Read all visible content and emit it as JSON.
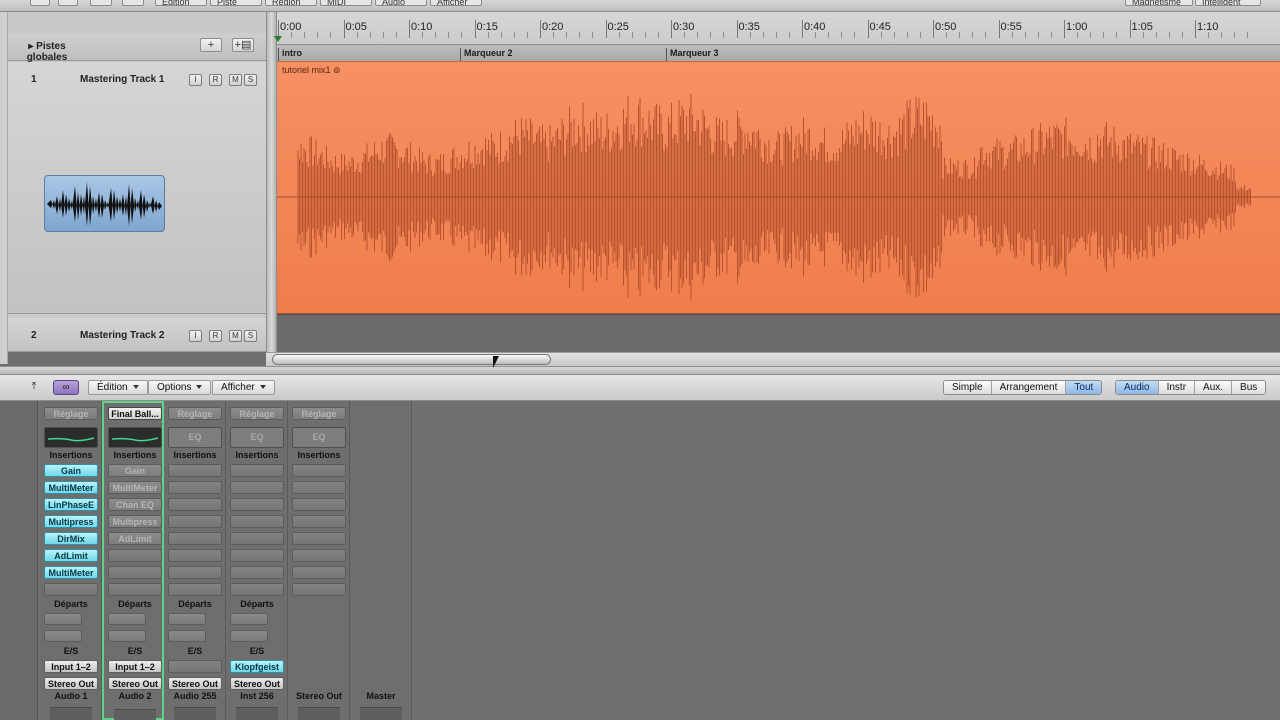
{
  "topbar": {
    "items": [
      "Édition",
      "Piste",
      "Région",
      "MIDI",
      "Audio",
      "Afficher"
    ],
    "right": [
      "Magnétisme :",
      "Intelligent"
    ]
  },
  "globals": {
    "label": "Pistes globales",
    "add": "+",
    "add2": "+▤"
  },
  "tracks": [
    {
      "num": "1",
      "name": "Mastering Track 1",
      "buttons": [
        "I",
        "R",
        "M",
        "S"
      ]
    },
    {
      "num": "2",
      "name": "Mastering Track 2",
      "buttons": [
        "I",
        "R",
        "M",
        "S"
      ]
    }
  ],
  "ruler": {
    "ticks": [
      "0:00",
      "0:05",
      "0:10",
      "0:15",
      "0:20",
      "0:25",
      "0:30",
      "0:35",
      "0:40",
      "0:45",
      "0:50",
      "0:55",
      "1:00",
      "1:05",
      "1:10"
    ],
    "markers": [
      "intro",
      "Marqueur 2",
      "Marqueur 3"
    ]
  },
  "region": {
    "name": "tutoriel mix1"
  },
  "mixer_toolbar": {
    "menus": [
      "Édition",
      "Options",
      "Afficher"
    ],
    "views": [
      {
        "label": "Simple",
        "on": false
      },
      {
        "label": "Arrangement",
        "on": false
      },
      {
        "label": "Tout",
        "on": true
      }
    ],
    "filters": [
      {
        "label": "Audio",
        "on": true
      },
      {
        "label": "Instr",
        "on": false
      },
      {
        "label": "Aux.",
        "on": false
      },
      {
        "label": "Bus",
        "on": false
      }
    ]
  },
  "mixer": {
    "section_labels": {
      "insertions": "Insertions",
      "departs": "Départs",
      "es": "E/S",
      "eq": "EQ",
      "setting": "Réglage"
    },
    "strips": [
      {
        "setting": "Réglage",
        "eq": "curve",
        "inserts": [
          "Gain",
          "MultiMeter",
          "LinPhaseE",
          "Multipress",
          "DirMix",
          "AdLimit",
          "MultiMeter"
        ],
        "insert_state": "on",
        "input": "Input 1–2",
        "output": "Stereo Out",
        "name": "Audio 1",
        "selected": false
      },
      {
        "setting": "Final Ball...",
        "eq": "curve",
        "inserts": [
          "Gain",
          "MultiMeter",
          "Chan EQ",
          "Multipress",
          "AdLimit"
        ],
        "insert_state": "dim",
        "input": "Input 1–2",
        "output": "Stereo Out",
        "name": "Audio 2",
        "selected": true
      },
      {
        "setting": "Réglage",
        "eq": "text",
        "inserts": [],
        "insert_state": "none",
        "input": "",
        "output": "Stereo Out",
        "name": "Audio 255",
        "selected": false
      },
      {
        "setting": "Réglage",
        "eq": "text",
        "inserts": [],
        "insert_state": "none",
        "input": "Klopfgeist",
        "output": "Stereo Out",
        "name": "Inst 256",
        "selected": false
      },
      {
        "setting": "Réglage",
        "eq": "text",
        "inserts": [],
        "insert_state": "none",
        "input": "",
        "output": "",
        "name": "Stereo Out",
        "selected": false,
        "no_sends": true
      },
      {
        "setting": "",
        "eq": "none",
        "inserts": [],
        "insert_state": "none",
        "input": "",
        "output": "",
        "name": "Master",
        "selected": false,
        "bare": true
      }
    ]
  },
  "colors": {
    "region": "#f08352",
    "waveform": "#b8532d",
    "insert_on": "#86e0ef",
    "selected_strip": "#5fd38a"
  }
}
